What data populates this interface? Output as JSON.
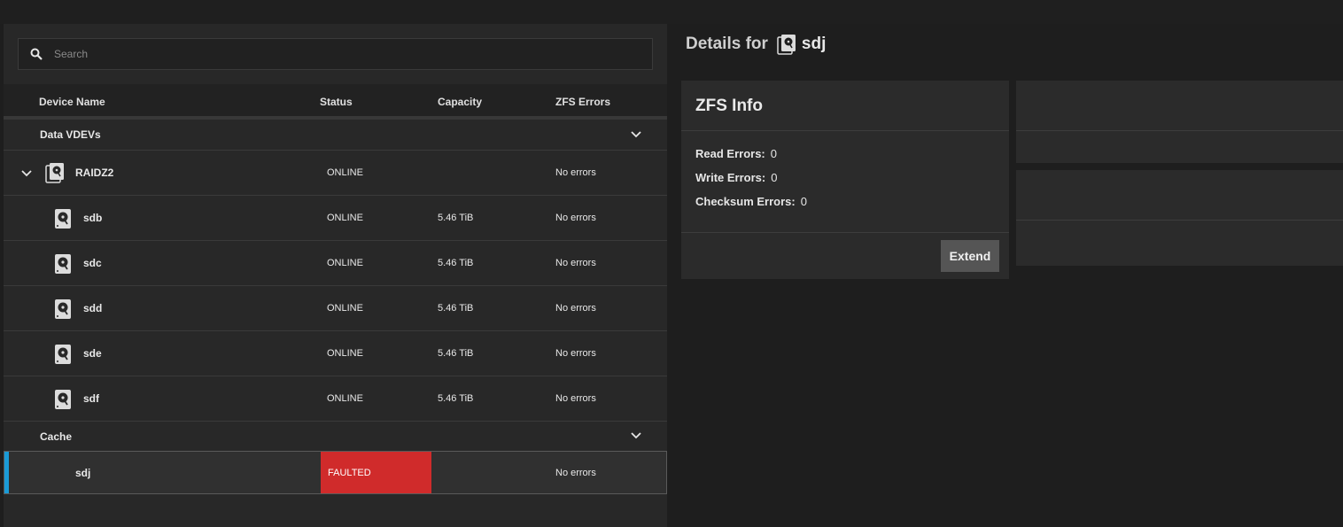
{
  "search": {
    "placeholder": "Search"
  },
  "table": {
    "columns": {
      "name": "Device Name",
      "status": "Status",
      "capacity": "Capacity",
      "errors": "ZFS Errors"
    }
  },
  "groups": {
    "data": {
      "label": "Data VDEVs"
    },
    "cache": {
      "label": "Cache"
    }
  },
  "vdev": {
    "name": "RAIDZ2",
    "status": "ONLINE",
    "errors": "No errors"
  },
  "disks": [
    {
      "name": "sdb",
      "status": "ONLINE",
      "capacity": "5.46 TiB",
      "errors": "No errors"
    },
    {
      "name": "sdc",
      "status": "ONLINE",
      "capacity": "5.46 TiB",
      "errors": "No errors"
    },
    {
      "name": "sdd",
      "status": "ONLINE",
      "capacity": "5.46 TiB",
      "errors": "No errors"
    },
    {
      "name": "sde",
      "status": "ONLINE",
      "capacity": "5.46 TiB",
      "errors": "No errors"
    },
    {
      "name": "sdf",
      "status": "ONLINE",
      "capacity": "5.46 TiB",
      "errors": "No errors"
    }
  ],
  "cache_disk": {
    "name": "sdj",
    "status": "FAULTED",
    "errors": "No errors"
  },
  "details": {
    "prefix": "Details for",
    "device": "sdj",
    "zfs_info": {
      "title": "ZFS Info",
      "read_label": "Read Errors:",
      "read_value": "0",
      "write_label": "Write Errors:",
      "write_value": "0",
      "checksum_label": "Checksum Errors:",
      "checksum_value": "0",
      "extend_label": "Extend"
    }
  },
  "colors": {
    "faulted": "#d02b2b",
    "selection": "#1a9bd7"
  },
  "icons": [
    "search-icon",
    "hard-disk-icon",
    "disk-stack-icon",
    "chevron-down-icon"
  ]
}
